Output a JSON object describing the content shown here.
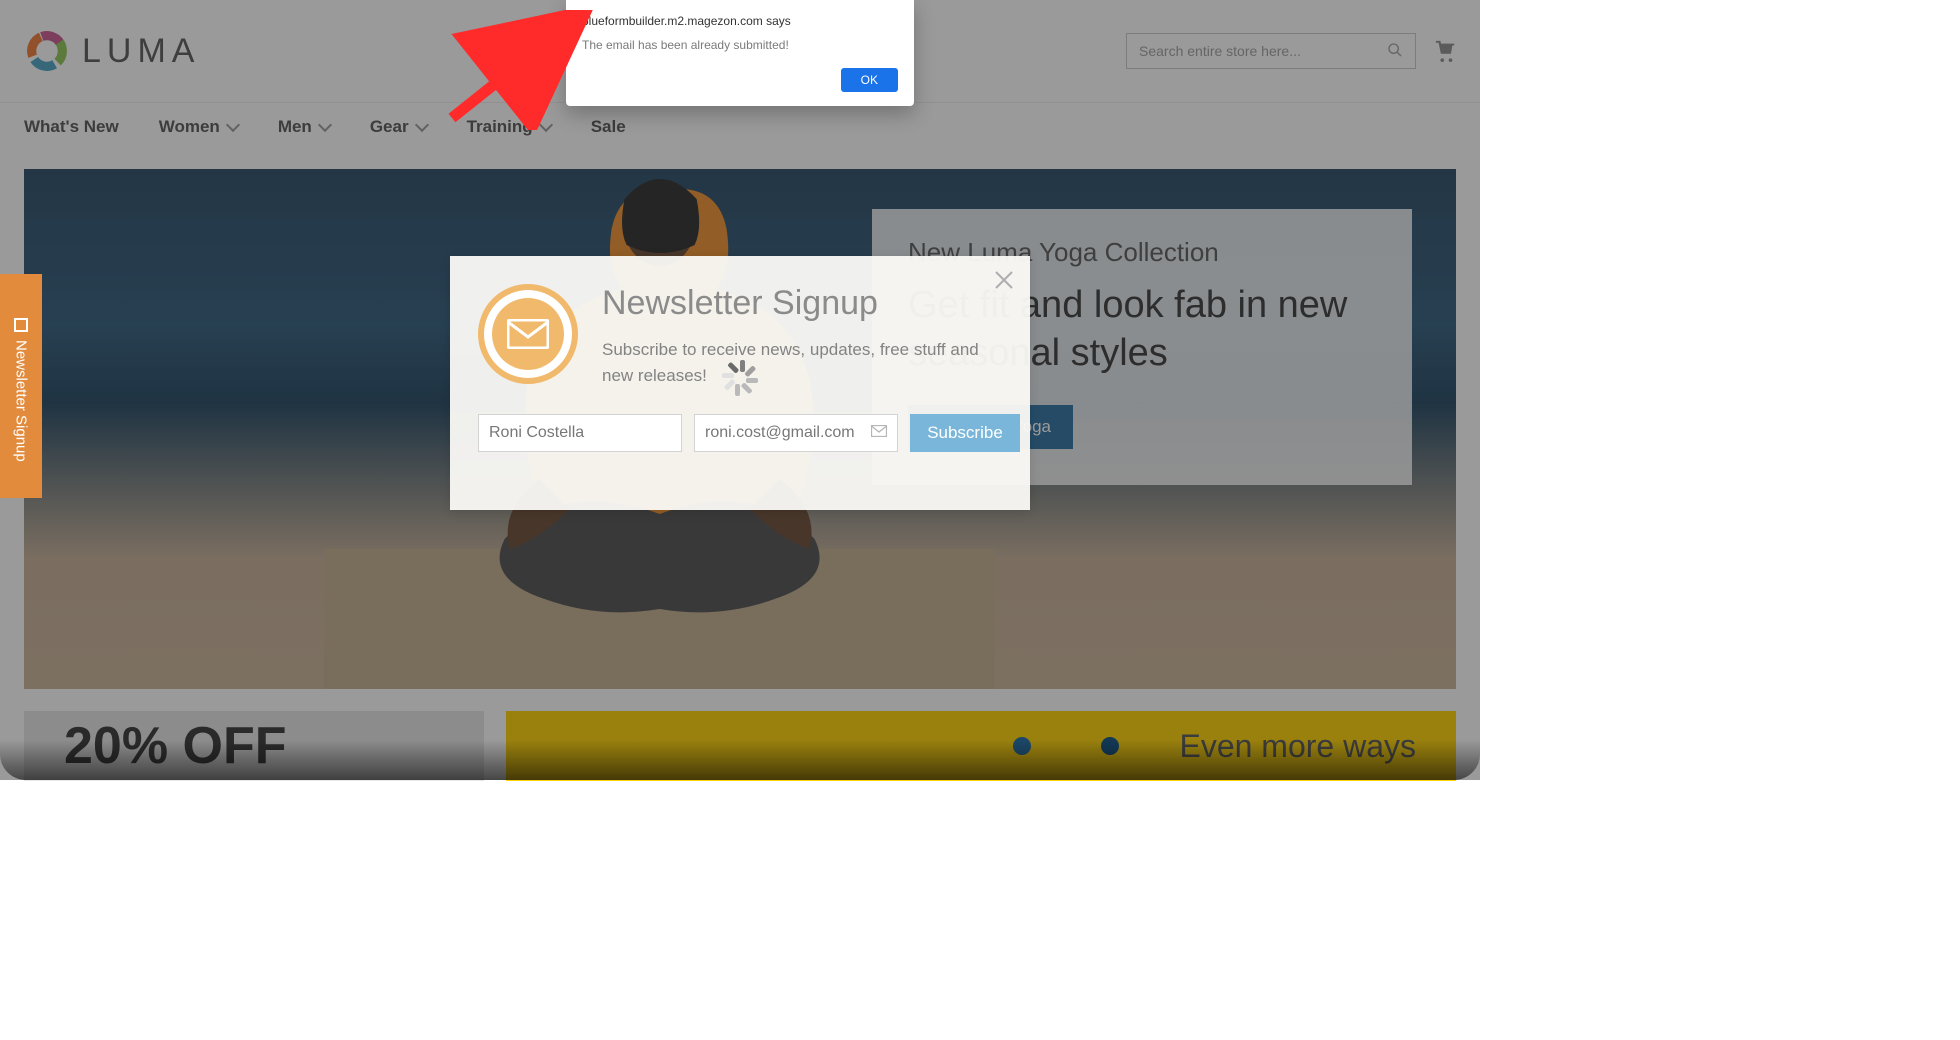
{
  "header": {
    "logo_text": "LUMA",
    "search_placeholder": "Search entire store here..."
  },
  "nav": {
    "items": [
      {
        "label": "What's New",
        "dropdown": false
      },
      {
        "label": "Women",
        "dropdown": true
      },
      {
        "label": "Men",
        "dropdown": true
      },
      {
        "label": "Gear",
        "dropdown": true
      },
      {
        "label": "Training",
        "dropdown": true
      },
      {
        "label": "Sale",
        "dropdown": false
      }
    ]
  },
  "side_tab": {
    "label": "Newsletter Signup"
  },
  "hero": {
    "card_eyebrow": "New Luma Yoga Collection",
    "card_title": "Get fit and look fab in new seasonal styles",
    "cta_label": "Shop New Yoga"
  },
  "lower": {
    "promo_a": "20% OFF",
    "promo_b": "Even more ways"
  },
  "newsletter": {
    "heading": "Newsletter Signup",
    "subheading": "Subscribe to receive news, updates, free stuff and new releases!",
    "name_value": "Roni Costella",
    "email_value": "roni.cost@gmail.com",
    "subscribe_label": "Subscribe"
  },
  "alert": {
    "domain_line": "blueformbuilder.m2.magezon.com says",
    "message": "The email has been already submitted!",
    "ok_label": "OK"
  }
}
